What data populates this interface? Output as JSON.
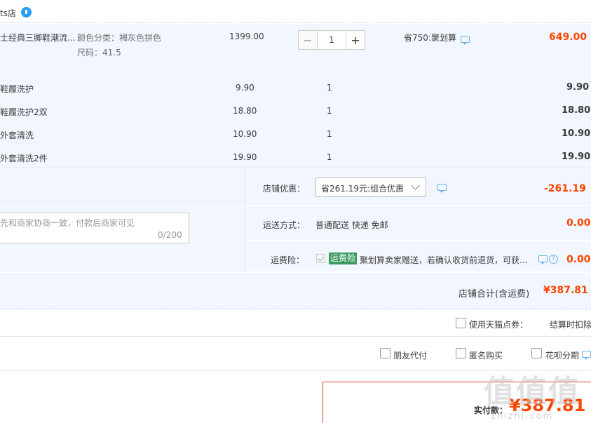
{
  "shop": {
    "name": "ts店"
  },
  "main_item": {
    "title": "士经典三脚鞋潮流...",
    "color_label": "颜色分类：褐灰色拼色",
    "size_label": "尺码：41.5",
    "price": "1399.00",
    "quantity": "1",
    "promo": "省750:聚划算",
    "subtotal": "649.00"
  },
  "addon_items": [
    {
      "name": "鞋履洗护",
      "price": "9.90",
      "qty": "1",
      "subtotal": "9.90"
    },
    {
      "name": "鞋履洗护2双",
      "price": "18.80",
      "qty": "1",
      "subtotal": "18.80"
    },
    {
      "name": "外套清洗",
      "price": "10.90",
      "qty": "1",
      "subtotal": "10.90"
    },
    {
      "name": "外套清洗2件",
      "price": "19.90",
      "qty": "1",
      "subtotal": "19.90"
    }
  ],
  "memo": {
    "placeholder": "先和商家协商一致，付款后商家可见",
    "count": "0/200"
  },
  "options": {
    "shop_discount": {
      "label": "店铺优惠：",
      "selected": "省261.19元:组合优惠",
      "amount": "-261.19"
    },
    "shipping": {
      "label": "运送方式：",
      "value": "普通配送 快递 免邮",
      "amount": "0.00"
    },
    "freight_insurance": {
      "label": "运费险：",
      "badge": "运费险",
      "text": "聚划算卖家赠送，若确认收货前退货，可获...",
      "amount": "0.00"
    }
  },
  "shop_total": {
    "label": "店铺合计(含运费)",
    "amount": "¥387.81"
  },
  "tmall_points": {
    "label": "使用天猫点券：",
    "note": "结算时扣除"
  },
  "pay_options": {
    "friend": "朋友代付",
    "anonymous": "匿名购买",
    "huabei": "花呗分期"
  },
  "payment": {
    "label": "实付款：",
    "amount": "¥387.81"
  },
  "watermark": {
    "main": "值值值",
    "sub": "zhizhi.com"
  }
}
